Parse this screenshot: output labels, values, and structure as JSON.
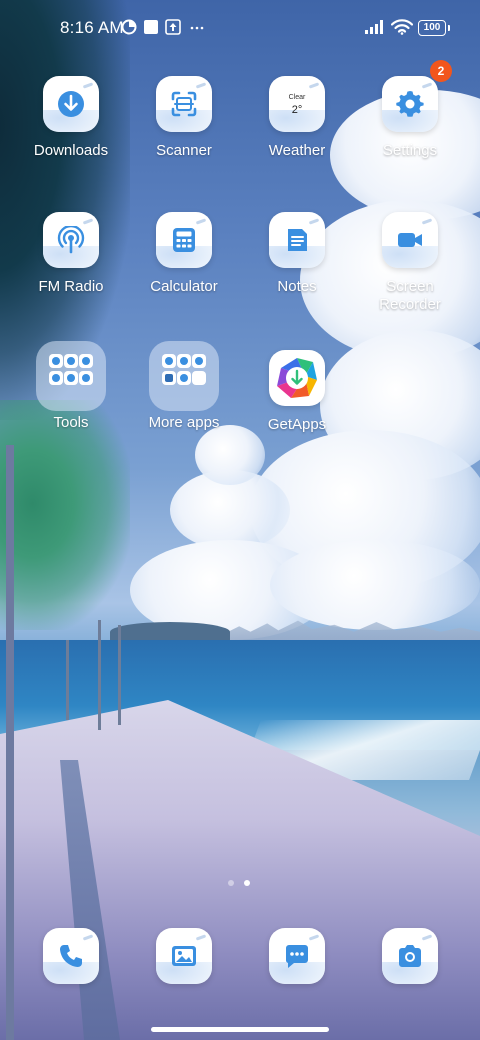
{
  "status_bar": {
    "time": "8:16 AM",
    "battery": "100",
    "icons": [
      "data-saver-icon",
      "notification-square-icon",
      "upload-icon",
      "more-dots-icon",
      "signal-icon",
      "wifi-icon",
      "battery-icon"
    ]
  },
  "home": {
    "row1": [
      {
        "label": "Downloads",
        "icon": "download-arrow-icon"
      },
      {
        "label": "Scanner",
        "icon": "scan-frame-icon"
      },
      {
        "label": "Weather",
        "icon": "weather-icon",
        "condition": "Clear",
        "temp": "2°"
      },
      {
        "label": "Settings",
        "icon": "gear-icon",
        "badge": "2"
      }
    ],
    "row2": [
      {
        "label": "FM Radio",
        "icon": "radio-signal-icon"
      },
      {
        "label": "Calculator",
        "icon": "calculator-icon"
      },
      {
        "label": "Notes",
        "icon": "notes-icon"
      },
      {
        "label": "Screen\nRecorder",
        "label_line1": "Screen",
        "label_line2": "Recorder",
        "icon": "video-camera-icon"
      }
    ],
    "row3": [
      {
        "label": "Tools",
        "icon": "folder-icon"
      },
      {
        "label": "More apps",
        "icon": "folder-icon"
      },
      {
        "label": "GetApps",
        "icon": "getapps-icon"
      }
    ]
  },
  "page_indicator": {
    "pages": 2,
    "current": 2
  },
  "dock": [
    {
      "name": "Phone",
      "icon": "phone-icon"
    },
    {
      "name": "Gallery",
      "icon": "gallery-icon"
    },
    {
      "name": "Messages",
      "icon": "message-bubble-icon"
    },
    {
      "name": "Camera",
      "icon": "camera-icon"
    }
  ],
  "colors": {
    "accent": "#3a8fe0",
    "badge": "#f2561d",
    "label": "#ffffff"
  }
}
